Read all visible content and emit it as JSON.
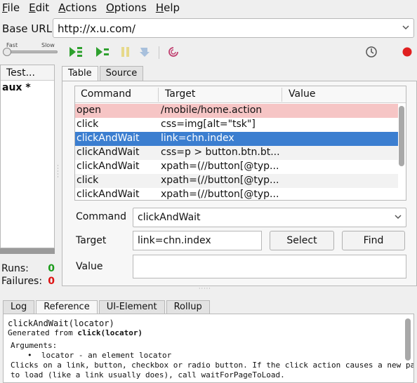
{
  "menu": [
    {
      "label": "File",
      "mnemonic": "F",
      "rest": "ile"
    },
    {
      "label": "Edit",
      "mnemonic": "E",
      "rest": "dit"
    },
    {
      "label": "Actions",
      "mnemonic": "A",
      "rest": "ctions"
    },
    {
      "label": "Options",
      "mnemonic": "O",
      "rest": "ptions"
    },
    {
      "label": "Help",
      "mnemonic": "H",
      "rest": "elp"
    }
  ],
  "base_url": {
    "label": "Base URL",
    "value": "http://x.u.com/"
  },
  "speed": {
    "fast_label": "Fast",
    "slow_label": "Slow",
    "level": 0
  },
  "toolbar_icons": [
    "play-suite-icon",
    "play-test-icon",
    "pause-icon",
    "step-icon",
    "rollup-icon",
    "schedule-clock-icon",
    "record-icon"
  ],
  "tests": {
    "header": "Test...",
    "items": [
      "aux *"
    ]
  },
  "stats": {
    "runs_label": "Runs:",
    "runs": "0",
    "failures_label": "Failures:",
    "failures": "0"
  },
  "tabs": [
    "Table",
    "Source"
  ],
  "grid": {
    "columns": [
      "Command",
      "Target",
      "Value"
    ],
    "rows": [
      {
        "command": "open",
        "target": "/mobile/home.action",
        "state": "open"
      },
      {
        "command": "click",
        "target": "css=img[alt=\"tsk\"]",
        "state": ""
      },
      {
        "command": "clickAndWait",
        "target": "link=chn.index",
        "state": "selected"
      },
      {
        "command": "clickAndWait",
        "target": "css=p > button.btn.bt...",
        "state": "alt"
      },
      {
        "command": "clickAndWait",
        "target": "xpath=(//button[@typ...",
        "state": ""
      },
      {
        "command": "click",
        "target": "xpath=(//button[@typ...",
        "state": "alt"
      },
      {
        "command": "clickAndWait",
        "target": "xpath=(//button[@typ...",
        "state": ""
      }
    ]
  },
  "form": {
    "command_label": "Command",
    "command_value": "clickAndWait",
    "target_label": "Target",
    "target_value": "link=chn.index",
    "select_button": "Select",
    "find_button": "Find",
    "value_label": "Value",
    "value_value": ""
  },
  "bottom_tabs": [
    "Log",
    "Reference",
    "UI-Element",
    "Rollup"
  ],
  "reference": {
    "signature": "clickAndWait(locator)",
    "generated_prefix": "Generated from ",
    "generated_from": "click(locator)",
    "arguments_label": "Arguments:",
    "argument": "locator - an element locator",
    "desc1": "Clicks on a link, button, checkbox or radio button. If the click action causes a new page",
    "desc2": "to load (like a link usually does), call waitForPageToLoad."
  },
  "colors": {
    "selected": "#3b7ed0",
    "open_row": "#f6c5c5",
    "runs": "#1a9a1a",
    "failures": "#dd1111",
    "record": "#e02020"
  }
}
